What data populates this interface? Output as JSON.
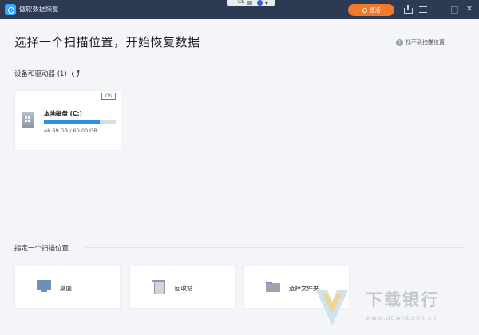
{
  "window": {
    "app_title": "傲软数据恢复",
    "lang_label": "CK",
    "activate_label": "激活"
  },
  "header": {
    "title": "选择一个扫描位置，开始恢复数据",
    "help_link": "找不到扫描位置"
  },
  "devices": {
    "section_title": "设备和驱动器 (1)",
    "drives": [
      {
        "name": "本地磁盘 (C:)",
        "badge": "OS",
        "size_text": "46.69 GB / 60.00 GB",
        "used_fraction": 0.78
      }
    ]
  },
  "locations": {
    "section_title": "指定一个扫描位置",
    "items": [
      {
        "label": "桌面",
        "icon": "desktop-icon"
      },
      {
        "label": "回收站",
        "icon": "recycle-bin-icon"
      },
      {
        "label": "选择文件夹",
        "icon": "folder-icon"
      }
    ]
  },
  "watermark": {
    "text": "下载银行",
    "url": "www.downbank.cn"
  },
  "colors": {
    "titlebar": "#2d3a53",
    "accent": "#f07a2a",
    "progress": "#2f8ee5",
    "os_badge": "#2ea44f"
  }
}
